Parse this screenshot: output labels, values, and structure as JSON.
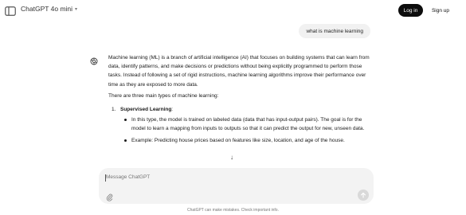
{
  "header": {
    "model_name": "ChatGPT 4o mini",
    "login_label": "Log in",
    "signup_label": "Sign up"
  },
  "conversation": {
    "user_message": "what is machine learning",
    "assistant": {
      "intro": "Machine learning (ML) is a branch of artificial intelligence (AI) that focuses on building systems that can learn from data, identify patterns, and make decisions or predictions without being explicitly programmed to perform those tasks. Instead of following a set of rigid instructions, machine learning algorithms improve their performance over time as they are exposed to more data.",
      "lead": "There are three main types of machine learning:",
      "list": [
        {
          "num": "1.",
          "heading": "Supervised Learning",
          "suffix": ":",
          "bullets": [
            "In this type, the model is trained on labeled data (data that has input-output pairs). The goal is for the model to learn a mapping from inputs to outputs so that it can predict the output for new, unseen data.",
            "Example: Predicting house prices based on features like size, location, and age of the house."
          ]
        }
      ]
    }
  },
  "composer": {
    "placeholder": "Message ChatGPT"
  },
  "footer": {
    "disclaimer": "ChatGPT can make mistakes. Check important info."
  }
}
